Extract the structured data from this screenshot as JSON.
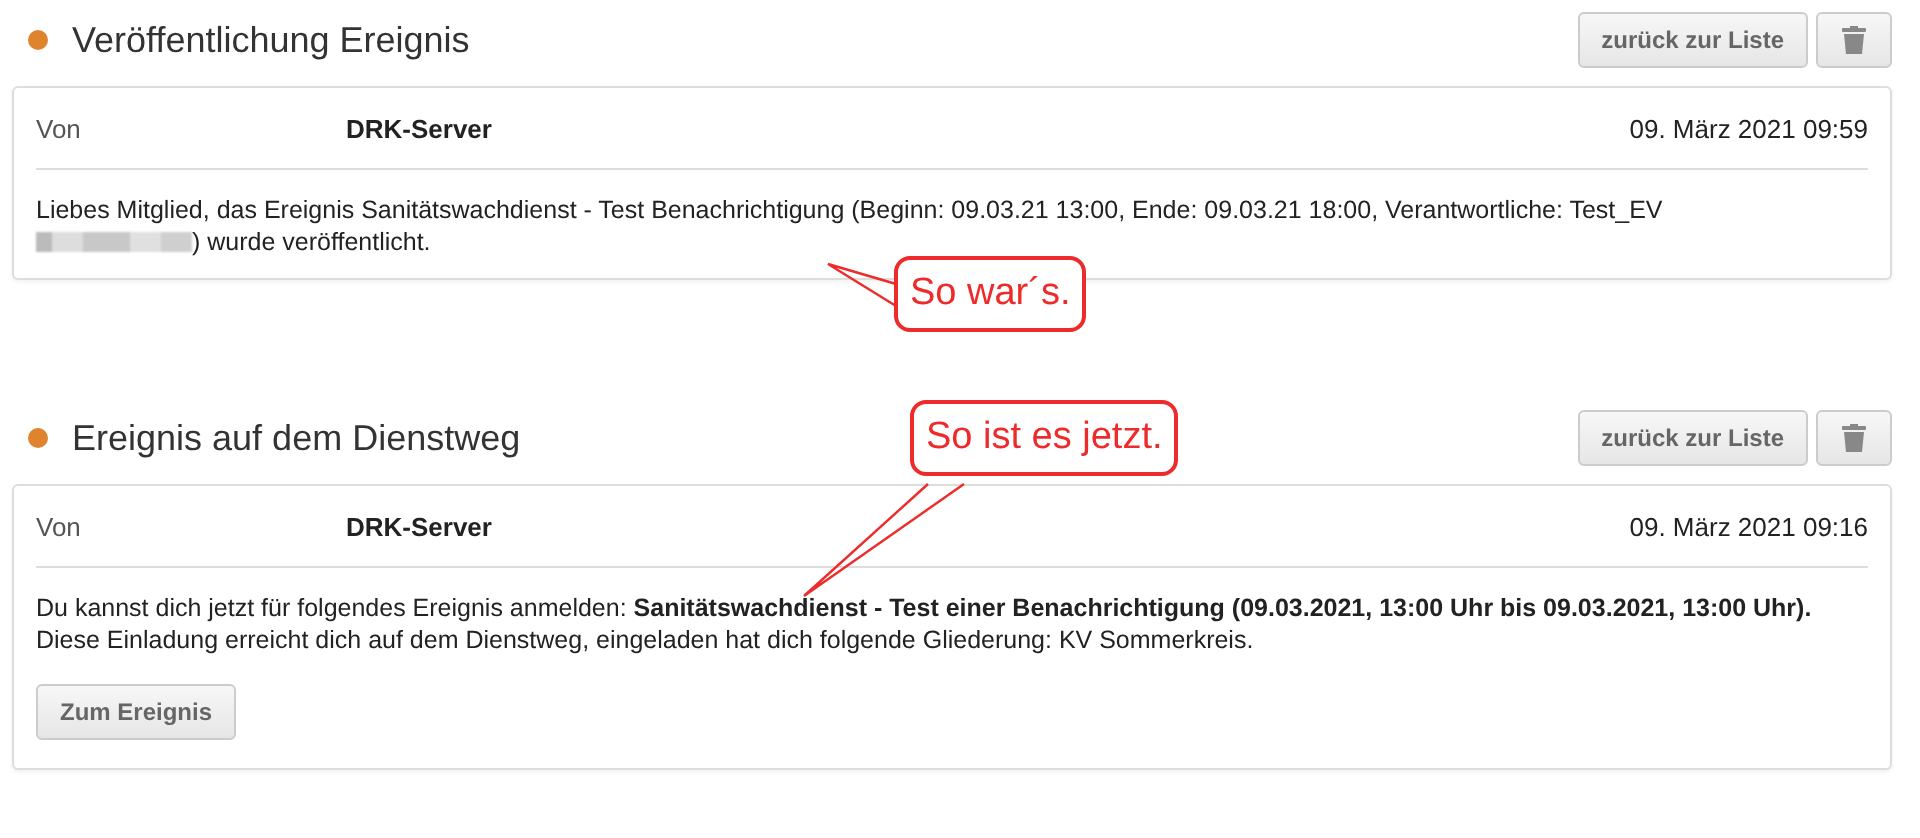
{
  "sections": [
    {
      "title": "Veröffentlichung Ereignis",
      "color": "#e0832d",
      "back_button": "zurück zur Liste",
      "from_label": "Von",
      "sender": "DRK-Server",
      "date": "09. März 2021 09:59",
      "kind": "redacted",
      "body_line_1": "Liebes Mitglied, das Ereignis Sanitätswachdienst - Test Benachrichtigung (Beginn: 09.03.21 13:00, Ende: 09.03.21 18:00, Verantwortliche: Test_EV",
      "body_line_2": ") wurde veröffentlicht.",
      "callout": "So war´s."
    },
    {
      "title": "Ereignis auf dem Dienstweg",
      "color": "#e0832d",
      "back_button": "zurück zur Liste",
      "from_label": "Von",
      "sender": "DRK-Server",
      "date": "09. März 2021 09:16",
      "kind": "invite",
      "body_line_1": "Du kannst dich jetzt für folgendes Ereignis anmelden: **Sanitätswachdienst - Test einer Benachrichtigung (09.03.2021, 13:00 Uhr bis 09.03.2021, 13:00 Uhr).**",
      "body_line_2": "Diese Einladung erreicht dich auf dem Dienstweg, eingeladen hat dich folgende Gliederung: KV Sommerkreis.",
      "action_button": "Zum Ereignis",
      "callout": "So ist es jetzt."
    }
  ]
}
